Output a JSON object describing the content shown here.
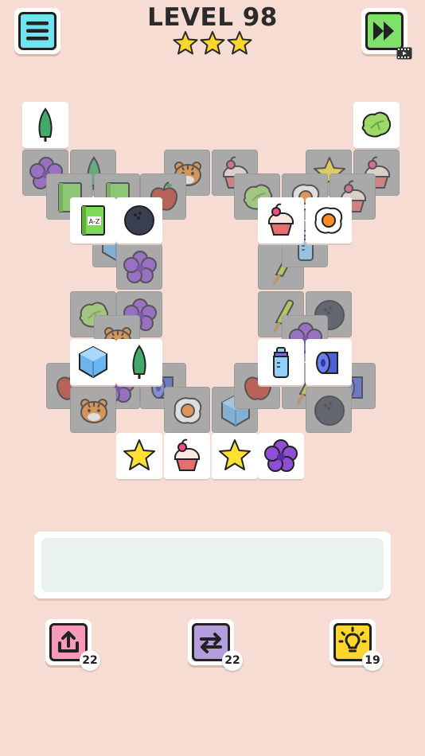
{
  "header": {
    "level_label": "LEVEL 98",
    "stars_earned": 3,
    "stars_total": 3
  },
  "buttons": {
    "menu": {
      "icon": "menu-icon",
      "color": "#6fe3ef"
    },
    "skip": {
      "icon": "fast-forward-icon",
      "color": "#7fe06a",
      "ad_icon": "video-ad-icon"
    }
  },
  "board": {
    "back_layer_icons": [
      "violet-flower",
      "tree",
      "tiger",
      "cupcake",
      "star",
      "cupcake",
      "green-book",
      "green-book",
      "apple",
      "lettuce",
      "egg",
      "cupcake",
      "cube",
      "violet-flower",
      "popsicle",
      "bottle",
      "lettuce",
      "violet-flower",
      "tiger",
      "popsicle",
      "bowling-ball",
      "violet-flower",
      "apple",
      "violet-flower",
      "toilet-paper",
      "cube",
      "apple",
      "popsicle",
      "toilet-paper",
      "tiger",
      "egg",
      "bowling-ball"
    ],
    "top_layer_icons": [
      "tree",
      "lettuce",
      "az-book",
      "bowling-ball",
      "cupcake",
      "egg",
      "cube",
      "tree",
      "bottle",
      "toilet-paper",
      "star",
      "cupcake",
      "star",
      "violet-flower"
    ]
  },
  "tray": {
    "slots_filled": 0
  },
  "powerups": [
    {
      "name": "undo",
      "icon": "undo-icon",
      "count": "22",
      "color": "#f79bb8"
    },
    {
      "name": "shuffle",
      "icon": "shuffle-icon",
      "count": "22",
      "color": "#b39ddb"
    },
    {
      "name": "hint",
      "icon": "lightbulb-icon",
      "count": "19",
      "color": "#ffd52e"
    }
  ]
}
